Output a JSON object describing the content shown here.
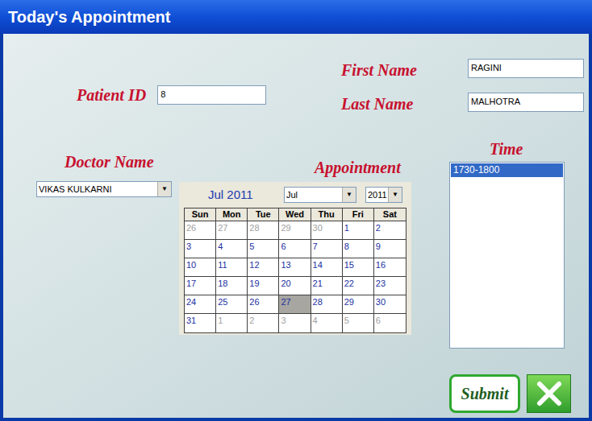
{
  "window": {
    "title": "Today's Appointment"
  },
  "patient": {
    "label": "Patient ID",
    "value": "8"
  },
  "first_name": {
    "label": "First Name",
    "value": "RAGINI"
  },
  "last_name": {
    "label": "Last Name",
    "value": "MALHOTRA"
  },
  "doctor": {
    "label": "Doctor Name",
    "value": "VIKAS KULKARNI",
    "arrow": "▼"
  },
  "appointment": {
    "label": "Appointment",
    "calendar": {
      "title": "Jul 2011",
      "month": "Jul",
      "year": "2011",
      "arrow": "▼",
      "weekdays": [
        "Sun",
        "Mon",
        "Tue",
        "Wed",
        "Thu",
        "Fri",
        "Sat"
      ],
      "weeks": [
        [
          {
            "day": "26",
            "current": false,
            "selected": false
          },
          {
            "day": "27",
            "current": false,
            "selected": false
          },
          {
            "day": "28",
            "current": false,
            "selected": false
          },
          {
            "day": "29",
            "current": false,
            "selected": false
          },
          {
            "day": "30",
            "current": false,
            "selected": false
          },
          {
            "day": "1",
            "current": true,
            "selected": false
          },
          {
            "day": "2",
            "current": true,
            "selected": false
          }
        ],
        [
          {
            "day": "3",
            "current": true,
            "selected": false
          },
          {
            "day": "4",
            "current": true,
            "selected": false
          },
          {
            "day": "5",
            "current": true,
            "selected": false
          },
          {
            "day": "6",
            "current": true,
            "selected": false
          },
          {
            "day": "7",
            "current": true,
            "selected": false
          },
          {
            "day": "8",
            "current": true,
            "selected": false
          },
          {
            "day": "9",
            "current": true,
            "selected": false
          }
        ],
        [
          {
            "day": "10",
            "current": true,
            "selected": false
          },
          {
            "day": "11",
            "current": true,
            "selected": false
          },
          {
            "day": "12",
            "current": true,
            "selected": false
          },
          {
            "day": "13",
            "current": true,
            "selected": false
          },
          {
            "day": "14",
            "current": true,
            "selected": false
          },
          {
            "day": "15",
            "current": true,
            "selected": false
          },
          {
            "day": "16",
            "current": true,
            "selected": false
          }
        ],
        [
          {
            "day": "17",
            "current": true,
            "selected": false
          },
          {
            "day": "18",
            "current": true,
            "selected": false
          },
          {
            "day": "19",
            "current": true,
            "selected": false
          },
          {
            "day": "20",
            "current": true,
            "selected": false
          },
          {
            "day": "21",
            "current": true,
            "selected": false
          },
          {
            "day": "22",
            "current": true,
            "selected": false
          },
          {
            "day": "23",
            "current": true,
            "selected": false
          }
        ],
        [
          {
            "day": "24",
            "current": true,
            "selected": false
          },
          {
            "day": "25",
            "current": true,
            "selected": false
          },
          {
            "day": "26",
            "current": true,
            "selected": false
          },
          {
            "day": "27",
            "current": true,
            "selected": true
          },
          {
            "day": "28",
            "current": true,
            "selected": false
          },
          {
            "day": "29",
            "current": true,
            "selected": false
          },
          {
            "day": "30",
            "current": true,
            "selected": false
          }
        ],
        [
          {
            "day": "31",
            "current": true,
            "selected": false
          },
          {
            "day": "1",
            "current": false,
            "selected": false
          },
          {
            "day": "2",
            "current": false,
            "selected": false
          },
          {
            "day": "3",
            "current": false,
            "selected": false
          },
          {
            "day": "4",
            "current": false,
            "selected": false
          },
          {
            "day": "5",
            "current": false,
            "selected": false
          },
          {
            "day": "6",
            "current": false,
            "selected": false
          }
        ]
      ]
    }
  },
  "time": {
    "label": "Time",
    "slots": [
      {
        "label": "1730-1800",
        "selected": true
      }
    ]
  },
  "buttons": [
    {
      "kind": "submit",
      "label": "Submit"
    },
    {
      "kind": "close",
      "label": ""
    }
  ]
}
